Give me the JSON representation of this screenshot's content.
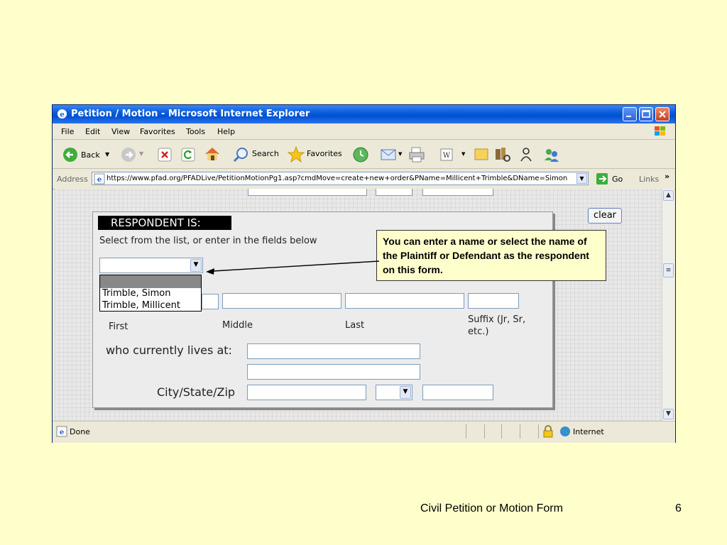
{
  "window": {
    "title": "Petition / Motion - Microsoft Internet Explorer"
  },
  "menu": [
    "File",
    "Edit",
    "View",
    "Favorites",
    "Tools",
    "Help"
  ],
  "toolbar": {
    "back_label": "Back",
    "search_label": "Search",
    "favorites_label": "Favorites"
  },
  "address": {
    "label": "Address",
    "url": "https://www.pfad.org/PFADLive/PetitionMotionPg1.asp?cmdMove=create+new+order&PName=Millicent+Trimble&DName=Simon",
    "go_label": "Go",
    "links_label": "Links"
  },
  "form": {
    "header": "RESPONDENT IS:",
    "instruction": "Select from the list, or enter in the fields below",
    "dropdown_options": [
      "",
      "Trimble, Simon",
      "Trimble, Millicent"
    ],
    "label_first": "First",
    "label_middle": "Middle",
    "label_last": "Last",
    "label_suffix": "Suffix (Jr, Sr, etc.)",
    "label_lives_at": "who currently lives at:",
    "label_city": "City/State/Zip",
    "clear_label": "clear"
  },
  "callout": {
    "text": "You can enter a name or select the name of the Plaintiff or Defendant as the respondent on this form."
  },
  "status": {
    "text": "Done",
    "zone": "Internet"
  },
  "slide": {
    "footer": "Civil Petition or Motion Form",
    "number": "6"
  }
}
